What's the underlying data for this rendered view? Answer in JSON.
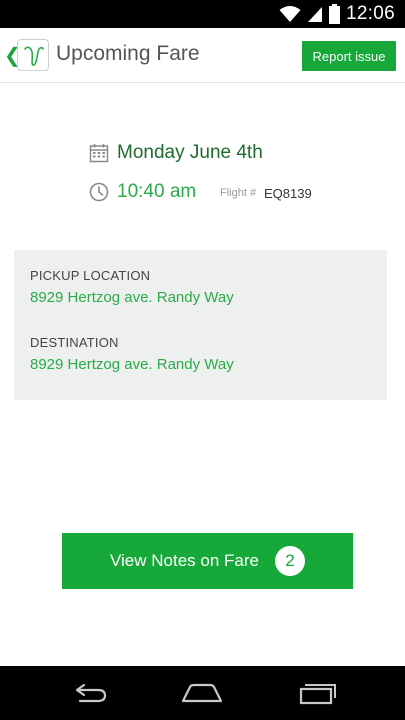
{
  "status_bar": {
    "time": "12:06",
    "icons": [
      "wifi-icon",
      "signal-icon",
      "battery-icon"
    ]
  },
  "app_bar": {
    "back_icon": "chevron-left-icon",
    "logo_icon": "app-logo-icon",
    "title": "Upcoming Fare",
    "report_label": "Report issue"
  },
  "fare": {
    "date_icon": "calendar-icon",
    "date": "Monday June 4th",
    "time_icon": "clock-icon",
    "time": "10:40 am",
    "flight_label": "Flight #",
    "flight_number": "EQ8139"
  },
  "locations": {
    "pickup_label": "PICKUP LOCATION",
    "pickup_value": "8929 Hertzog ave. Randy Way",
    "destination_label": "DESTINATION",
    "destination_value": "8929 Hertzog ave. Randy Way"
  },
  "notes_button": {
    "label": "View Notes on Fare",
    "count": "2"
  },
  "nav_bar": {
    "icons": [
      "back-icon",
      "home-icon",
      "recent-apps-icon"
    ]
  },
  "colors": {
    "accent": "#17a83a",
    "accent_text": "#2bab4a",
    "date_text": "#1e6b2e",
    "card_bg": "#eeefef"
  }
}
